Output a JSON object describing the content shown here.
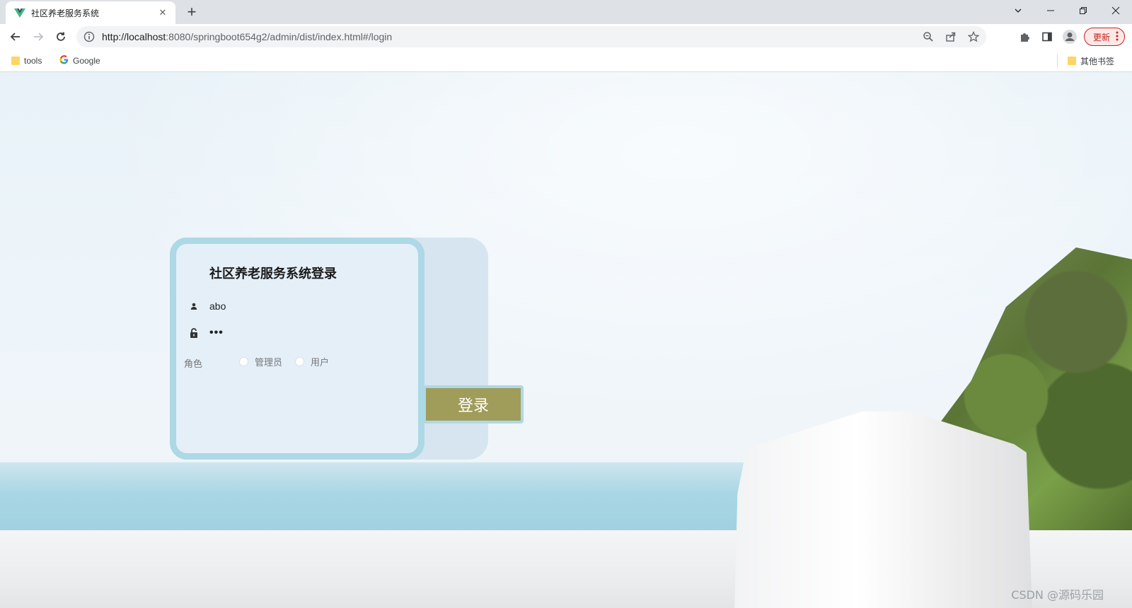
{
  "browser": {
    "tab_title": "社区养老服务系统",
    "url_host": "http://localhost",
    "url_rest": ":8080/springboot654g2/admin/dist/index.html#/login",
    "update_label": "更新",
    "icons": [
      "vue-favicon",
      "close-icon",
      "plus-icon",
      "chevron-down-icon",
      "minimize-icon",
      "restore-icon",
      "window-close-icon",
      "back-arrow-icon",
      "forward-arrow-icon",
      "reload-icon",
      "info-icon",
      "zoom-icon",
      "share-icon",
      "star-icon",
      "puzzle-icon",
      "sidepanel-icon",
      "profile-icon",
      "kebab-icon",
      "folder-icon",
      "google-icon"
    ]
  },
  "bookmarks": {
    "items": [
      {
        "label": "tools"
      },
      {
        "label": "Google"
      }
    ],
    "other_label": "其他书签"
  },
  "login": {
    "title": "社区养老服务系统登录",
    "username_value": "abo",
    "password_value": "•••",
    "role_label": "角色",
    "roles": [
      {
        "label": "管理员"
      },
      {
        "label": "用户"
      }
    ],
    "submit_label": "登录"
  },
  "watermark": "CSDN @源码乐园",
  "colors": {
    "card_border": "#add8e6",
    "card_bg": "#e4eff8",
    "button_bg": "#a09c5a"
  }
}
